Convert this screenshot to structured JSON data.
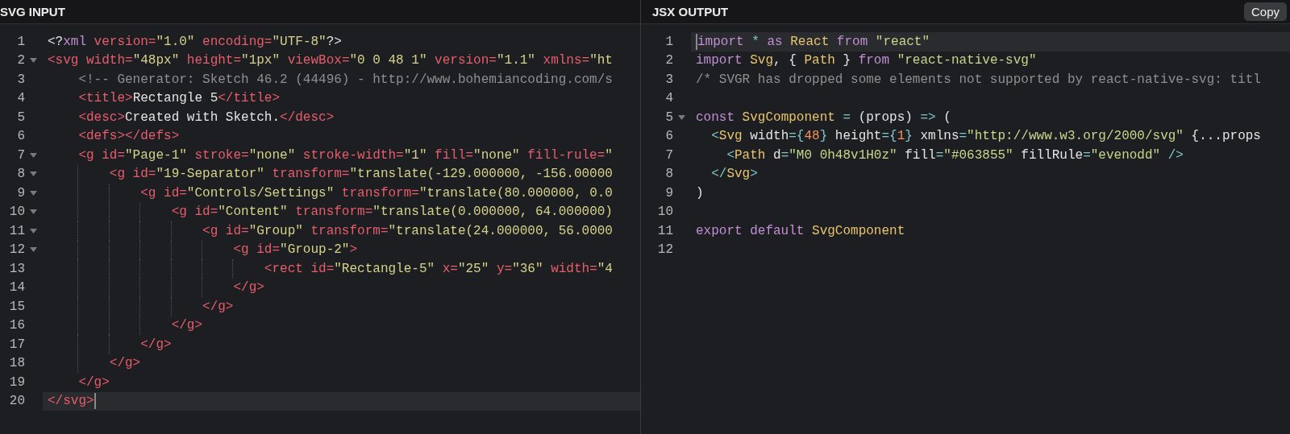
{
  "panes": [
    {
      "title": "SVG INPUT",
      "lines": [
        {
          "number": "1",
          "foldable": false,
          "active": false,
          "tokens": [
            {
              "kind": "plain",
              "text": "<?"
            },
            {
              "kind": "keyword",
              "text": "xml"
            },
            {
              "kind": "attr",
              "text": " version="
            },
            {
              "kind": "string",
              "text": "\"1.0\""
            },
            {
              "kind": "attr",
              "text": " encoding="
            },
            {
              "kind": "string",
              "text": "\"UTF-8\""
            },
            {
              "kind": "plain",
              "text": "?>"
            }
          ]
        },
        {
          "number": "2",
          "foldable": true,
          "active": false,
          "tokens": [
            {
              "kind": "tag",
              "text": "<svg"
            },
            {
              "kind": "attr",
              "text": " width="
            },
            {
              "kind": "string",
              "text": "\"48px\""
            },
            {
              "kind": "attr",
              "text": " height="
            },
            {
              "kind": "string",
              "text": "\"1px\""
            },
            {
              "kind": "attr",
              "text": " viewBox="
            },
            {
              "kind": "string",
              "text": "\"0 0 48 1\""
            },
            {
              "kind": "attr",
              "text": " version="
            },
            {
              "kind": "string",
              "text": "\"1.1\""
            },
            {
              "kind": "attr",
              "text": " xmlns="
            },
            {
              "kind": "string",
              "text": "\"ht"
            }
          ]
        },
        {
          "number": "3",
          "foldable": false,
          "active": false,
          "tokens": [
            {
              "kind": "comment",
              "text": "    <!-- Generator: Sketch 46.2 (44496) - http://www.bohemiancoding.com/s"
            }
          ]
        },
        {
          "number": "4",
          "foldable": false,
          "active": false,
          "tokens": [
            {
              "kind": "tag",
              "text": "    <title>"
            },
            {
              "kind": "plain",
              "text": "Rectangle 5"
            },
            {
              "kind": "tag",
              "text": "</title>"
            }
          ]
        },
        {
          "number": "5",
          "foldable": false,
          "active": false,
          "tokens": [
            {
              "kind": "tag",
              "text": "    <desc>"
            },
            {
              "kind": "plain",
              "text": "Created with Sketch."
            },
            {
              "kind": "tag",
              "text": "</desc>"
            }
          ]
        },
        {
          "number": "6",
          "foldable": false,
          "active": false,
          "tokens": [
            {
              "kind": "tag",
              "text": "    <defs></defs>"
            }
          ]
        },
        {
          "number": "7",
          "foldable": true,
          "active": false,
          "tokens": [
            {
              "kind": "tag",
              "text": "    <g"
            },
            {
              "kind": "attr",
              "text": " id="
            },
            {
              "kind": "string",
              "text": "\"Page-1\""
            },
            {
              "kind": "attr",
              "text": " stroke="
            },
            {
              "kind": "string",
              "text": "\"none\""
            },
            {
              "kind": "attr",
              "text": " stroke-width="
            },
            {
              "kind": "string",
              "text": "\"1\""
            },
            {
              "kind": "attr",
              "text": " fill="
            },
            {
              "kind": "string",
              "text": "\"none\""
            },
            {
              "kind": "attr",
              "text": " fill-rule="
            },
            {
              "kind": "string",
              "text": "\""
            }
          ]
        },
        {
          "number": "8",
          "foldable": true,
          "active": false,
          "tokens": [
            {
              "kind": "tag",
              "text": "        <g"
            },
            {
              "kind": "attr",
              "text": " id="
            },
            {
              "kind": "string",
              "text": "\"19-Separator\""
            },
            {
              "kind": "attr",
              "text": " transform="
            },
            {
              "kind": "string",
              "text": "\"translate(-129.000000, -156.00000"
            }
          ]
        },
        {
          "number": "9",
          "foldable": true,
          "active": false,
          "tokens": [
            {
              "kind": "tag",
              "text": "            <g"
            },
            {
              "kind": "attr",
              "text": " id="
            },
            {
              "kind": "string",
              "text": "\"Controls/Settings\""
            },
            {
              "kind": "attr",
              "text": " transform="
            },
            {
              "kind": "string",
              "text": "\"translate(80.000000, 0.0"
            }
          ]
        },
        {
          "number": "10",
          "foldable": true,
          "active": false,
          "tokens": [
            {
              "kind": "tag",
              "text": "                <g"
            },
            {
              "kind": "attr",
              "text": " id="
            },
            {
              "kind": "string",
              "text": "\"Content\""
            },
            {
              "kind": "attr",
              "text": " transform="
            },
            {
              "kind": "string",
              "text": "\"translate(0.000000, 64.000000)"
            }
          ]
        },
        {
          "number": "11",
          "foldable": true,
          "active": false,
          "tokens": [
            {
              "kind": "tag",
              "text": "                    <g"
            },
            {
              "kind": "attr",
              "text": " id="
            },
            {
              "kind": "string",
              "text": "\"Group\""
            },
            {
              "kind": "attr",
              "text": " transform="
            },
            {
              "kind": "string",
              "text": "\"translate(24.000000, 56.0000"
            }
          ]
        },
        {
          "number": "12",
          "foldable": true,
          "active": false,
          "tokens": [
            {
              "kind": "tag",
              "text": "                        <g"
            },
            {
              "kind": "attr",
              "text": " id="
            },
            {
              "kind": "string",
              "text": "\"Group-2\""
            },
            {
              "kind": "tag",
              "text": ">"
            }
          ]
        },
        {
          "number": "13",
          "foldable": false,
          "active": false,
          "tokens": [
            {
              "kind": "tag",
              "text": "                            <rect"
            },
            {
              "kind": "attr",
              "text": " id="
            },
            {
              "kind": "string",
              "text": "\"Rectangle-5\""
            },
            {
              "kind": "attr",
              "text": " x="
            },
            {
              "kind": "string",
              "text": "\"25\""
            },
            {
              "kind": "attr",
              "text": " y="
            },
            {
              "kind": "string",
              "text": "\"36\""
            },
            {
              "kind": "attr",
              "text": " width="
            },
            {
              "kind": "string",
              "text": "\"4"
            }
          ]
        },
        {
          "number": "14",
          "foldable": false,
          "active": false,
          "tokens": [
            {
              "kind": "tag",
              "text": "                        </g>"
            }
          ]
        },
        {
          "number": "15",
          "foldable": false,
          "active": false,
          "tokens": [
            {
              "kind": "tag",
              "text": "                    </g>"
            }
          ]
        },
        {
          "number": "16",
          "foldable": false,
          "active": false,
          "tokens": [
            {
              "kind": "tag",
              "text": "                </g>"
            }
          ]
        },
        {
          "number": "17",
          "foldable": false,
          "active": false,
          "tokens": [
            {
              "kind": "tag",
              "text": "            </g>"
            }
          ]
        },
        {
          "number": "18",
          "foldable": false,
          "active": false,
          "tokens": [
            {
              "kind": "tag",
              "text": "        </g>"
            }
          ]
        },
        {
          "number": "19",
          "foldable": false,
          "active": false,
          "tokens": [
            {
              "kind": "tag",
              "text": "    </g>"
            }
          ]
        },
        {
          "number": "20",
          "foldable": false,
          "active": true,
          "caret_at_end": true,
          "tokens": [
            {
              "kind": "tag",
              "text": "</svg>"
            }
          ]
        }
      ]
    },
    {
      "title": "JSX OUTPUT",
      "copy_button": "Copy",
      "lines": [
        {
          "number": "1",
          "foldable": false,
          "active": true,
          "caret_at_end": false,
          "tokens": [
            {
              "kind": "keyword",
              "text": "import"
            },
            {
              "kind": "punct",
              "text": " *"
            },
            {
              "kind": "keyword",
              "text": " as"
            },
            {
              "kind": "type",
              "text": " React"
            },
            {
              "kind": "keyword",
              "text": " from"
            },
            {
              "kind": "string2",
              "text": " \"react\""
            }
          ]
        },
        {
          "number": "2",
          "foldable": false,
          "active": false,
          "tokens": [
            {
              "kind": "keyword",
              "text": "import"
            },
            {
              "kind": "type",
              "text": " Svg"
            },
            {
              "kind": "plain",
              "text": ", {"
            },
            {
              "kind": "type",
              "text": " Path"
            },
            {
              "kind": "plain",
              "text": " }"
            },
            {
              "kind": "keyword",
              "text": " from"
            },
            {
              "kind": "string2",
              "text": " \"react-native-svg\""
            }
          ]
        },
        {
          "number": "3",
          "foldable": false,
          "active": false,
          "tokens": [
            {
              "kind": "comment",
              "text": "/* SVGR has dropped some elements not supported by react-native-svg: titl"
            }
          ]
        },
        {
          "number": "4",
          "foldable": false,
          "active": false
        },
        {
          "number": "5",
          "foldable": true,
          "active": false,
          "tokens": [
            {
              "kind": "keyword",
              "text": "const"
            },
            {
              "kind": "type",
              "text": " SvgComponent"
            },
            {
              "kind": "punct",
              "text": " ="
            },
            {
              "kind": "plain",
              "text": " (props)"
            },
            {
              "kind": "punct",
              "text": " =>"
            },
            {
              "kind": "plain",
              "text": " ("
            }
          ]
        },
        {
          "number": "6",
          "foldable": false,
          "active": false,
          "tokens": [
            {
              "kind": "punct",
              "text": "  <"
            },
            {
              "kind": "type",
              "text": "Svg"
            },
            {
              "kind": "plain",
              "text": " width"
            },
            {
              "kind": "punct",
              "text": "={"
            },
            {
              "kind": "number",
              "text": "48"
            },
            {
              "kind": "punct",
              "text": "}"
            },
            {
              "kind": "plain",
              "text": " height"
            },
            {
              "kind": "punct",
              "text": "={"
            },
            {
              "kind": "number",
              "text": "1"
            },
            {
              "kind": "punct",
              "text": "}"
            },
            {
              "kind": "plain",
              "text": " xmlns"
            },
            {
              "kind": "punct",
              "text": "="
            },
            {
              "kind": "string2",
              "text": "\"http://www.w3.org/2000/svg\""
            },
            {
              "kind": "plain",
              "text": " {...props"
            }
          ]
        },
        {
          "number": "7",
          "foldable": false,
          "active": false,
          "tokens": [
            {
              "kind": "punct",
              "text": "    <"
            },
            {
              "kind": "type",
              "text": "Path"
            },
            {
              "kind": "plain",
              "text": " d"
            },
            {
              "kind": "punct",
              "text": "="
            },
            {
              "kind": "string2",
              "text": "\"M0 0h48v1H0z\""
            },
            {
              "kind": "plain",
              "text": " fill"
            },
            {
              "kind": "punct",
              "text": "="
            },
            {
              "kind": "string2",
              "text": "\"#063855\""
            },
            {
              "kind": "plain",
              "text": " fillRule"
            },
            {
              "kind": "punct",
              "text": "="
            },
            {
              "kind": "string2",
              "text": "\"evenodd\""
            },
            {
              "kind": "punct",
              "text": " />"
            }
          ]
        },
        {
          "number": "8",
          "foldable": false,
          "active": false,
          "tokens": [
            {
              "kind": "punct",
              "text": "  </"
            },
            {
              "kind": "type",
              "text": "Svg"
            },
            {
              "kind": "punct",
              "text": ">"
            }
          ]
        },
        {
          "number": "9",
          "foldable": false,
          "active": false,
          "tokens": [
            {
              "kind": "plain",
              "text": ")"
            }
          ]
        },
        {
          "number": "10",
          "foldable": false,
          "active": false
        },
        {
          "number": "11",
          "foldable": false,
          "active": false,
          "tokens": [
            {
              "kind": "keyword",
              "text": "export"
            },
            {
              "kind": "keyword",
              "text": " default"
            },
            {
              "kind": "type",
              "text": " SvgComponent"
            }
          ]
        },
        {
          "number": "12",
          "foldable": false,
          "active": false
        }
      ]
    }
  ]
}
